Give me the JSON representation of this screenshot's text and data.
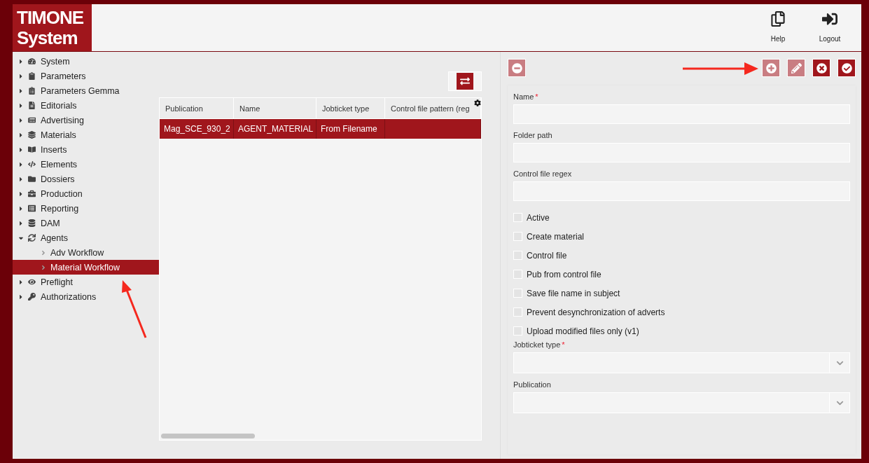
{
  "header": {
    "logo": [
      "TIMONE",
      "System"
    ],
    "actions": [
      {
        "label": "Help",
        "kind": "help"
      },
      {
        "label": "Logout",
        "kind": "logout"
      }
    ]
  },
  "sidebar": {
    "items": [
      {
        "label": "System",
        "expanded": false,
        "selected": false
      },
      {
        "label": "Parameters",
        "expanded": false,
        "selected": false
      },
      {
        "label": "Parameters Gemma",
        "expanded": false,
        "selected": false
      },
      {
        "label": "Editorials",
        "expanded": false,
        "selected": false
      },
      {
        "label": "Advertising",
        "expanded": false,
        "selected": false
      },
      {
        "label": "Materials",
        "expanded": false,
        "selected": false
      },
      {
        "label": "Inserts",
        "expanded": false,
        "selected": false
      },
      {
        "label": "Elements",
        "expanded": false,
        "selected": false
      },
      {
        "label": "Dossiers",
        "expanded": false,
        "selected": false
      },
      {
        "label": "Production",
        "expanded": false,
        "selected": false
      },
      {
        "label": "Reporting",
        "expanded": false,
        "selected": false
      },
      {
        "label": "DAM",
        "expanded": false,
        "selected": false
      },
      {
        "label": "Agents",
        "expanded": true,
        "selected": false,
        "children": [
          {
            "label": "Adv Workflow",
            "selected": false
          },
          {
            "label": "Material Workflow",
            "selected": true
          }
        ]
      },
      {
        "label": "Preflight",
        "expanded": false,
        "selected": false
      },
      {
        "label": "Authorizations",
        "expanded": false,
        "selected": false
      }
    ]
  },
  "table": {
    "columns": [
      "Publication",
      "Name",
      "Jobticket type",
      "Control file pattern (reg"
    ],
    "rows": [
      {
        "cells": [
          "Mag_SCE_930_2",
          "AGENT_MATERIAL",
          "From Filename",
          ""
        ],
        "selected": true
      }
    ]
  },
  "toolbar": [
    {
      "kind": "remove",
      "disabled": true
    },
    {
      "kind": "add",
      "disabled": true
    },
    {
      "kind": "edit",
      "disabled": true
    },
    {
      "kind": "cancel",
      "disabled": false
    },
    {
      "kind": "save",
      "disabled": false
    }
  ],
  "form": {
    "required_mark": "*",
    "fields": [
      {
        "kind": "text",
        "label": "Name",
        "required": true
      },
      {
        "kind": "text",
        "label": "Folder path",
        "required": false
      },
      {
        "kind": "text",
        "label": "Control file regex",
        "required": false
      },
      {
        "kind": "checkbox",
        "label": "Active",
        "checked": false
      },
      {
        "kind": "checkbox",
        "label": "Create material",
        "checked": false
      },
      {
        "kind": "checkbox",
        "label": "Control file",
        "checked": false
      },
      {
        "kind": "checkbox",
        "label": "Pub from control file",
        "checked": false
      },
      {
        "kind": "checkbox",
        "label": "Save file name in subject",
        "checked": false
      },
      {
        "kind": "checkbox",
        "label": "Prevent desynchronization of adverts",
        "checked": false
      },
      {
        "kind": "checkbox",
        "label": "Upload modified files only (v1)",
        "checked": false
      },
      {
        "kind": "select",
        "label": "Jobticket type",
        "required": true
      },
      {
        "kind": "select",
        "label": "Publication",
        "required": false
      }
    ]
  }
}
